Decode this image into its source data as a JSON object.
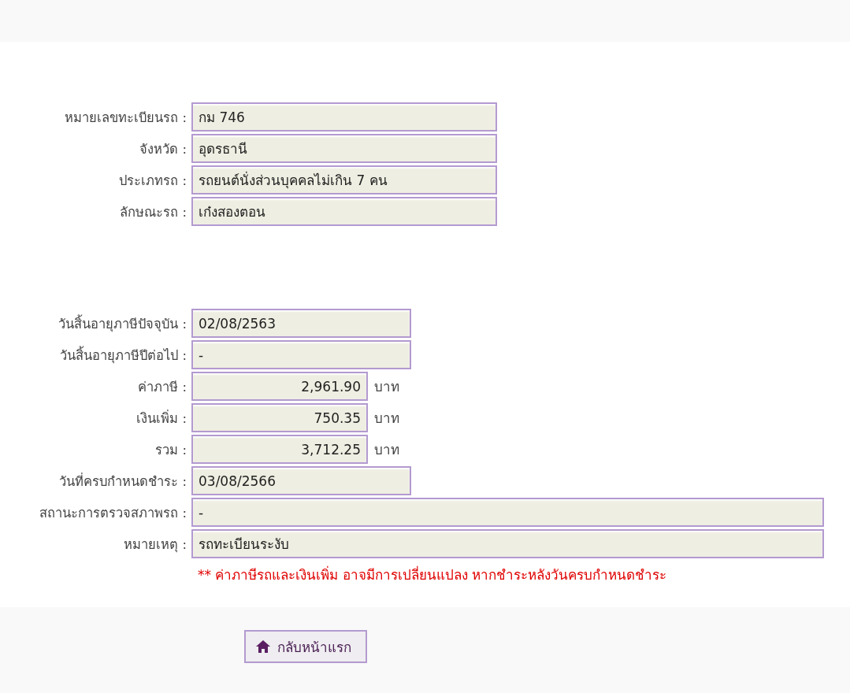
{
  "vehicle": [
    {
      "label": "หมายเลขทะเบียนรถ :",
      "value": "กม 746",
      "kind": "wide"
    },
    {
      "label": "จังหวัด :",
      "value": "อุดรธานี",
      "kind": "wide"
    },
    {
      "label": "ประเภทรถ :",
      "value": "รถยนต์นั่งส่วนบุคคลไม่เกิน 7 คน",
      "kind": "wide"
    },
    {
      "label": "ลักษณะรถ :",
      "value": "เก๋งสองตอน",
      "kind": "wide"
    }
  ],
  "tax": [
    {
      "label": "วันสิ้นอายุภาษีปัจจุบัน :",
      "value": "02/08/2563",
      "kind": "date"
    },
    {
      "label": "วันสิ้นอายุภาษีปีต่อไป :",
      "value": "-",
      "kind": "date"
    },
    {
      "label": "ค่าภาษี :",
      "value": "2,961.90",
      "kind": "amount",
      "unit": "บาท"
    },
    {
      "label": "เงินเพิ่ม :",
      "value": "750.35",
      "kind": "amount",
      "unit": "บาท"
    },
    {
      "label": "รวม :",
      "value": "3,712.25",
      "kind": "amount",
      "unit": "บาท"
    },
    {
      "label": "วันที่ครบกำหนดชำระ :",
      "value": "03/08/2566",
      "kind": "date"
    },
    {
      "label": "สถานะการตรวจสภาพรถ :",
      "value": "-",
      "kind": "note"
    },
    {
      "label": "หมายเหตุ :",
      "value": "รถทะเบียนระงับ",
      "kind": "note"
    }
  ],
  "warning": "** ค่าภาษีรถและเงินเพิ่ม อาจมีการเปลี่ยนแปลง หากชำระหลังวันครบกำหนดชำระ",
  "home_button": "กลับหน้าแรก"
}
